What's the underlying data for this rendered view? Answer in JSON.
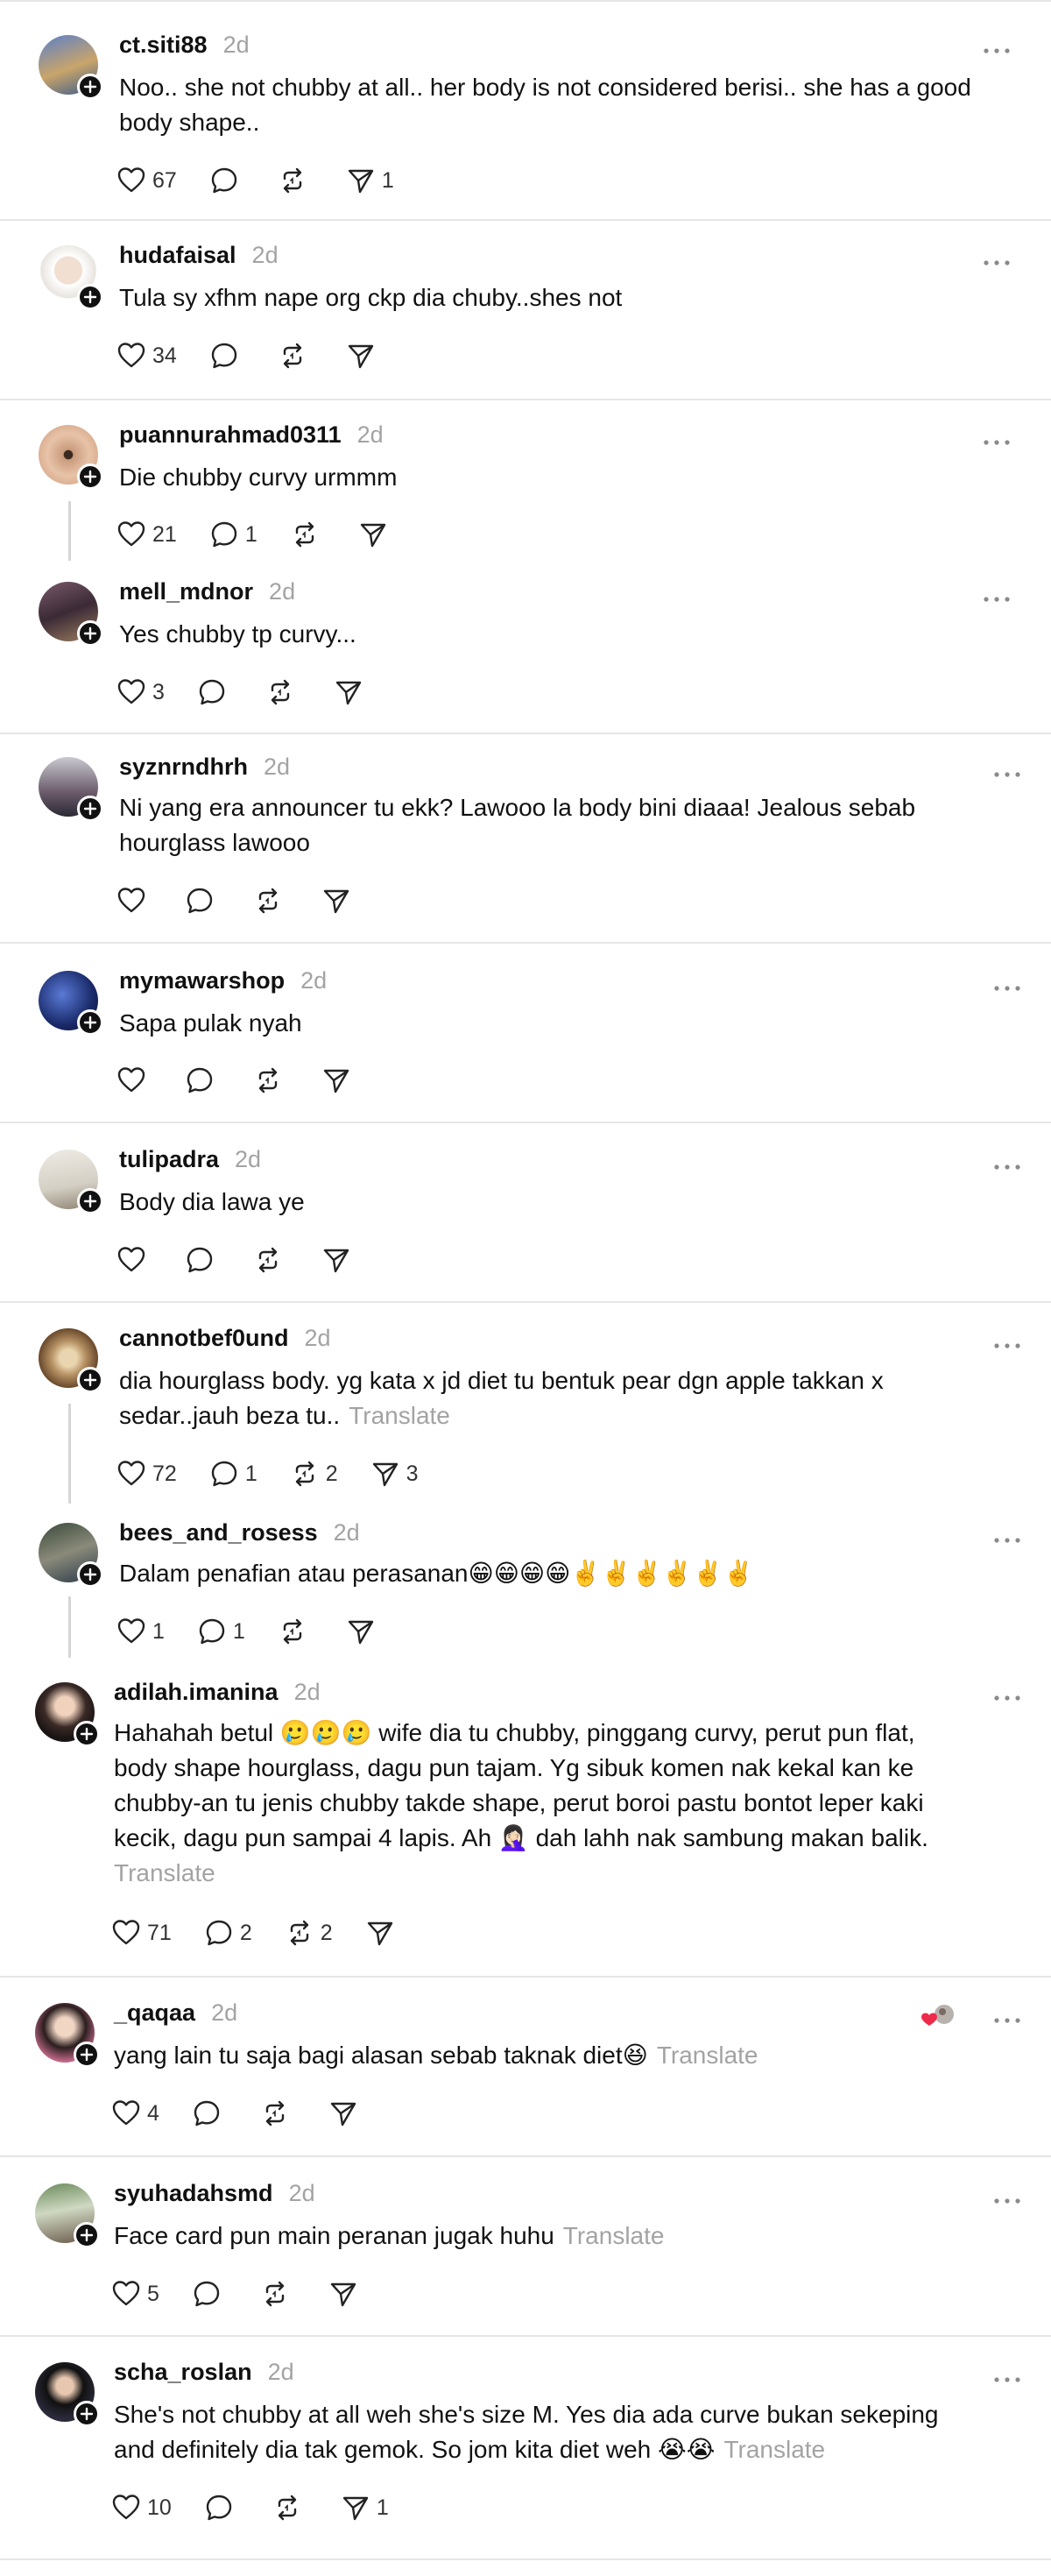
{
  "icons": {
    "like": "heart-outline-icon",
    "reply": "speech-bubble-icon",
    "repost": "repost-arrows-icon",
    "share": "send-paper-plane-icon",
    "more": "more-dots-icon",
    "follow": "plus-icon"
  },
  "colors": {
    "muted": "#a3a3a3",
    "divider": "#e6e6e6",
    "text": "#111111"
  },
  "posts": [
    {
      "username": "ct.siti88",
      "time": "2d",
      "lines": [
        "Noo.. she not chubby at all.. her body is not considered berisi.. she has a good",
        "body shape.."
      ],
      "translate": "",
      "likes": "67",
      "replies": "",
      "reposts": "",
      "shares": "1"
    },
    {
      "username": "hudafaisal",
      "time": "2d",
      "lines": [
        "Tula sy xfhm nape org ckp dia chuby..shes not"
      ],
      "translate": "",
      "likes": "34",
      "replies": "",
      "reposts": "",
      "shares": ""
    },
    {
      "username": "puannurahmad0311",
      "time": "2d",
      "lines": [
        "Die chubby curvy urmmm"
      ],
      "translate": "",
      "likes": "21",
      "replies": "1",
      "reposts": "",
      "shares": ""
    },
    {
      "username": "mell_mdnor",
      "time": "2d",
      "lines": [
        "Yes chubby tp curvy..."
      ],
      "translate": "",
      "likes": "3",
      "replies": "",
      "reposts": "",
      "shares": ""
    },
    {
      "username": "syznrndhrh",
      "time": "2d",
      "lines": [
        "Ni yang era announcer tu ekk? Lawooo la body bini diaaa! Jealous sebab",
        "hourglass lawooo"
      ],
      "translate": "",
      "likes": "",
      "replies": "",
      "reposts": "",
      "shares": ""
    },
    {
      "username": "mymawarshop",
      "time": "2d",
      "lines": [
        "Sapa pulak nyah"
      ],
      "translate": "",
      "likes": "",
      "replies": "",
      "reposts": "",
      "shares": ""
    },
    {
      "username": "tulipadra",
      "time": "2d",
      "lines": [
        "Body dia lawa ye"
      ],
      "translate": "",
      "likes": "",
      "replies": "",
      "reposts": "",
      "shares": ""
    },
    {
      "username": "cannotbef0und",
      "time": "2d",
      "lines": [
        "dia hourglass body. yg kata x jd diet tu bentuk pear dgn apple takkan x",
        "sedar..jauh beza tu.."
      ],
      "translate": "Translate",
      "likes": "72",
      "replies": "1",
      "reposts": "2",
      "shares": "3"
    },
    {
      "username": "bees_and_rosess",
      "time": "2d",
      "lines": [
        "Dalam penafian atau perasanan😁😁😁😁✌️✌️✌️✌️✌️✌️"
      ],
      "translate": "",
      "likes": "1",
      "replies": "1",
      "reposts": "",
      "shares": ""
    },
    {
      "username": "adilah.imanina",
      "time": "2d",
      "lines": [
        "Hahahah betul 🥲🥲🥲 wife dia tu chubby, pinggang curvy, perut pun flat,",
        "body shape hourglass, dagu pun tajam. Yg sibuk komen nak kekal kan ke",
        "chubby-an tu jenis chubby takde shape, perut boroi pastu bontot leper kaki",
        "kecik, dagu pun sampai 4 lapis. Ah 🤦🏻‍♀️ dah lahh nak sambung makan balik."
      ],
      "translate": "Translate",
      "likes": "71",
      "replies": "2",
      "reposts": "2",
      "shares": ""
    },
    {
      "username": "_qaqaa",
      "time": "2d",
      "lines": [
        "yang lain tu saja bagi alasan sebab taknak diet😆"
      ],
      "translate": "Translate",
      "likes": "4",
      "replies": "",
      "reposts": "",
      "shares": ""
    },
    {
      "username": "syuhadahsmd",
      "time": "2d",
      "lines": [
        "Face card pun main peranan jugak huhu"
      ],
      "translate": "Translate",
      "likes": "5",
      "replies": "",
      "reposts": "",
      "shares": ""
    },
    {
      "username": "scha_roslan",
      "time": "2d",
      "lines": [
        "She's not chubby at all weh she's size M. Yes dia ada curve bukan sekeping",
        "and definitely dia tak gemok. So jom kita diet weh 😭😭"
      ],
      "translate": "Translate",
      "likes": "10",
      "replies": "",
      "reposts": "",
      "shares": "1"
    }
  ]
}
